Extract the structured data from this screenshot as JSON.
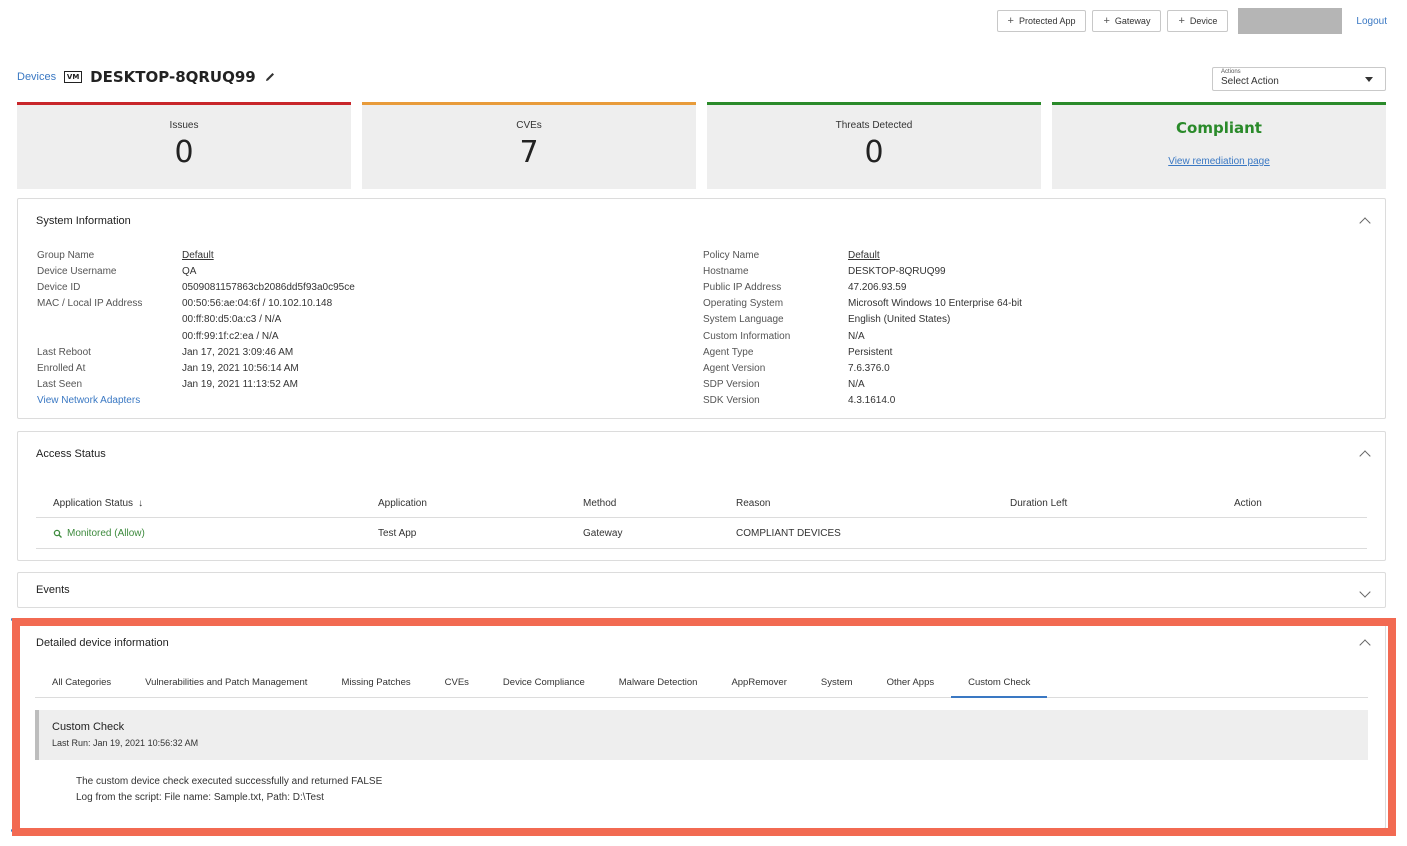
{
  "topbar": {
    "buttons": [
      "Protected App",
      "Gateway",
      "Device"
    ],
    "plus_icon": "+",
    "logout": "Logout"
  },
  "header": {
    "breadcrumb": "Devices",
    "vm_badge": "VM",
    "device_name": "DESKTOP-8QRUQ99",
    "actions_label": "Actions",
    "actions_value": "Select Action"
  },
  "cards": {
    "issues": {
      "title": "Issues",
      "value": "0",
      "color": "#c8262a"
    },
    "cves": {
      "title": "CVEs",
      "value": "7",
      "color": "#e89b3a"
    },
    "threats": {
      "title": "Threats Detected",
      "value": "0",
      "color": "#2a8a2a"
    },
    "status": {
      "title": "Compliant",
      "link": "View remediation page",
      "color": "#2a8a2a"
    }
  },
  "system_info": {
    "title": "System Information",
    "left": [
      {
        "label": "Group Name",
        "value": "Default",
        "link": true
      },
      {
        "label": "Device Username",
        "value": "QA"
      },
      {
        "label": "Device ID",
        "value": "0509081157863cb2086dd5f93a0c95ce"
      },
      {
        "label": "MAC / Local IP Address",
        "value": "00:50:56:ae:04:6f  /  10.102.10.148"
      },
      {
        "label": "",
        "value": "00:ff:80:d5:0a:c3  /  N/A"
      },
      {
        "label": "",
        "value": "00:ff:99:1f:c2:ea  /  N/A"
      },
      {
        "label": "Last Reboot",
        "value": "Jan 17, 2021 3:09:46 AM"
      },
      {
        "label": "Enrolled At",
        "value": "Jan 19, 2021 10:56:14 AM"
      },
      {
        "label": "Last Seen",
        "value": "Jan 19, 2021 11:13:52 AM"
      }
    ],
    "network_link": "View Network Adapters",
    "right": [
      {
        "label": "Policy Name",
        "value": "Default",
        "link": true
      },
      {
        "label": "Hostname",
        "value": "DESKTOP-8QRUQ99"
      },
      {
        "label": "Public IP Address",
        "value": "47.206.93.59"
      },
      {
        "label": "Operating System",
        "value": "Microsoft Windows 10 Enterprise 64-bit"
      },
      {
        "label": "System Language",
        "value": "English (United States)"
      },
      {
        "label": "Custom Information",
        "value": "N/A"
      },
      {
        "label": "Agent Type",
        "value": "Persistent"
      },
      {
        "label": "Agent Version",
        "value": "7.6.376.0"
      },
      {
        "label": "SDP Version",
        "value": "N/A"
      },
      {
        "label": "SDK Version",
        "value": "4.3.1614.0"
      }
    ]
  },
  "access_status": {
    "title": "Access Status",
    "columns": [
      "Application Status",
      "Application",
      "Method",
      "Reason",
      "Duration Left",
      "Action"
    ],
    "sort_icon": "↓",
    "rows": [
      {
        "status": "Monitored (Allow)",
        "application": "Test App",
        "method": "Gateway",
        "reason": "COMPLIANT DEVICES",
        "duration": "",
        "action": ""
      }
    ]
  },
  "events": {
    "title": "Events"
  },
  "detailed": {
    "title": "Detailed device information",
    "tabs": [
      "All Categories",
      "Vulnerabilities and Patch Management",
      "Missing Patches",
      "CVEs",
      "Device Compliance",
      "Malware Detection",
      "AppRemover",
      "System",
      "Other Apps",
      "Custom Check"
    ],
    "active_tab": "Custom Check",
    "check_title": "Custom Check",
    "last_run": "Last Run: Jan 19, 2021 10:56:32 AM",
    "result": "The custom device check executed successfully and returned FALSE",
    "log_label": "Log from the script:",
    "log_value": "File name: Sample.txt, Path: D:\\Test"
  },
  "colors": {
    "accent": "#3a78c3",
    "highlight": "#f26a52",
    "success": "#2a8a2a"
  }
}
